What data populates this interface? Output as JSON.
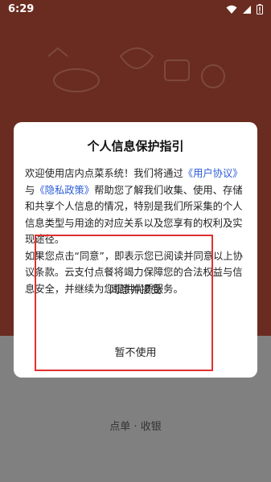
{
  "status_bar": {
    "time": "6:29"
  },
  "dialog": {
    "title": "个人信息保护指引",
    "body_p1_a": "欢迎使用店内点菜系统！我们将通过",
    "link_user_agreement": "《用户协议》",
    "body_p1_b": "与",
    "link_privacy_policy": "《隐私政策》",
    "body_p1_c": "帮助您了解我们收集、使用、存储和共享个人信息的情况，特别是我们所采集的个人信息类型与用途的对应关系以及您享有的权利及实现途径。",
    "body_p2": "如果您点击“同意”，即表示您已阅读并同意以上协议条款。云支付点餐将竭力保障您的合法权益与信息安全，并继续为您提供优质服务。",
    "agree_label": "同意并接受",
    "decline_label": "暂不使用"
  },
  "footer": {
    "text": "点单 · 收银"
  },
  "colors": {
    "top_bg": "#6a2c20",
    "bottom_bg": "#808080",
    "link": "#2a5bd7",
    "highlight_frame": "#e03030"
  },
  "icons": [
    "wifi-icon",
    "signal-icon",
    "battery-icon"
  ]
}
